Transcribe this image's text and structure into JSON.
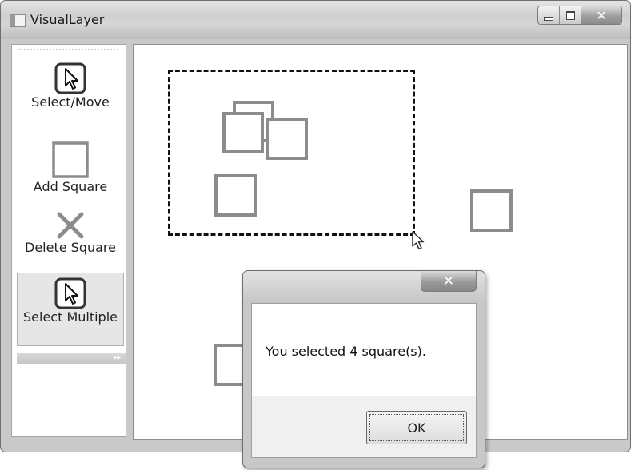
{
  "window": {
    "title": "VisualLayer",
    "buttons": {
      "minimize": "minimize",
      "maximize": "maximize",
      "close": "close"
    }
  },
  "toolbox": {
    "tools": [
      {
        "label": "Select/Move",
        "icon": "arrow-cursor-icon",
        "selected": false
      },
      {
        "label": "Add Square",
        "icon": "square-icon",
        "selected": false
      },
      {
        "label": "Delete Square",
        "icon": "x-icon",
        "selected": false
      },
      {
        "label": "Select Multiple",
        "icon": "arrow-cursor-icon",
        "selected": true
      }
    ]
  },
  "canvas": {
    "square_color": "#8c8c8c",
    "selection_border_color": "#111111"
  },
  "dialog": {
    "message": "You selected 4 square(s).",
    "ok_label": "OK",
    "close_glyph": "✕"
  }
}
